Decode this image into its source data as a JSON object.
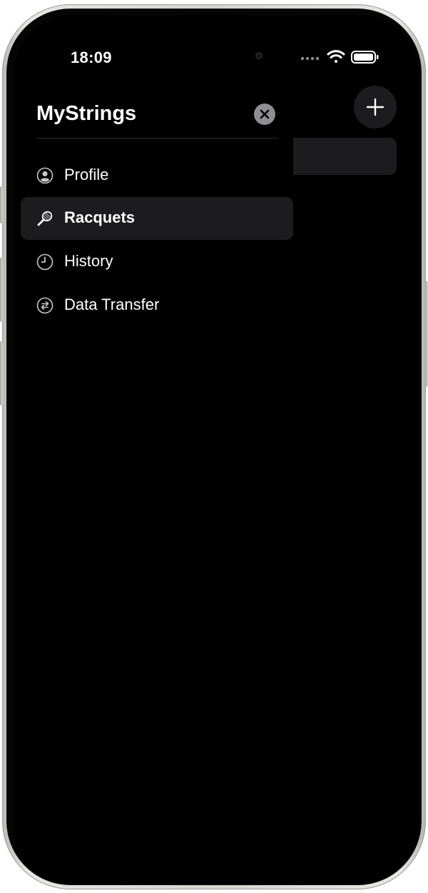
{
  "status_bar": {
    "time": "18:09",
    "icons": [
      "signal-icon",
      "wifi-icon",
      "battery-icon"
    ]
  },
  "menu": {
    "title": "MyStrings",
    "close_icon": "xmark-circle-icon",
    "items": [
      {
        "label": "Profile",
        "icon": "person-circle-icon",
        "active": false
      },
      {
        "label": "Racquets",
        "icon": "racquet-icon",
        "active": true
      },
      {
        "label": "History",
        "icon": "clock-icon",
        "active": false
      },
      {
        "label": "Data Transfer",
        "icon": "arrows-exchange-icon",
        "active": false
      }
    ]
  },
  "background_screen": {
    "add_icon": "plus-icon"
  },
  "colors": {
    "screen_bg": "#000000",
    "surface": "#1c1c1e",
    "close_button": "#8e8e93",
    "text": "#ffffff"
  }
}
